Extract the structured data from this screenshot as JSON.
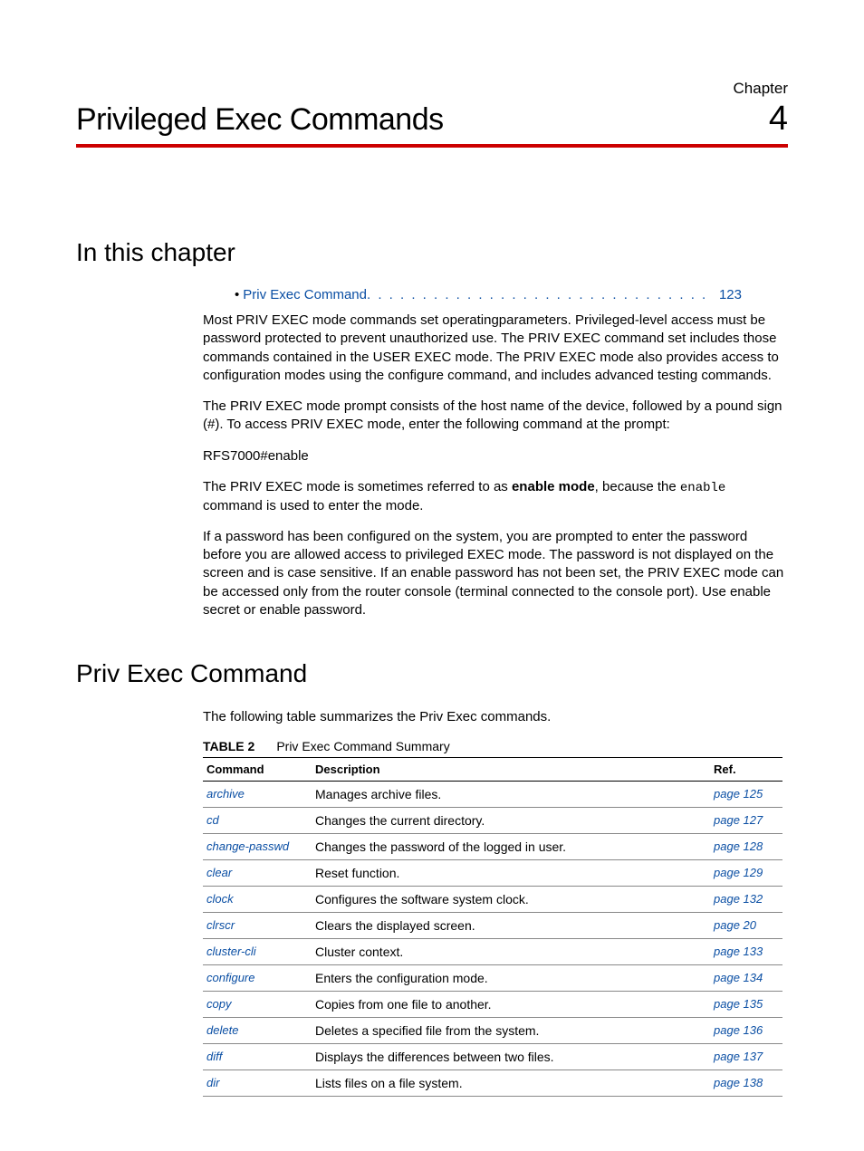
{
  "header": {
    "chapter_label": "Chapter",
    "title": "Privileged Exec Commands",
    "chapter_number": "4"
  },
  "section1": {
    "heading": "In this chapter",
    "toc": {
      "bullet": "•",
      "link_text": "Priv Exec Command",
      "dots": ". . . . . . . . . . . . . . . . . . . . . . . . . . . . . . . . . . . . . . . . . .",
      "page": "123"
    },
    "para1": "Most PRIV EXEC mode commands set operatingparameters. Privileged-level access must be password protected to prevent unauthorized use. The PRIV EXEC command set includes those commands contained in the USER EXEC mode. The PRIV EXEC mode also provides access to configuration modes using the configure command, and includes advanced testing commands.",
    "para2": "The PRIV EXEC mode prompt consists of the host name of the device, followed by a pound sign (#). To access PRIV EXEC mode, enter the following command at the prompt:",
    "code1": "RFS7000#enable",
    "para3_a": "The PRIV EXEC mode is sometimes referred to as ",
    "para3_b": "enable mode",
    "para3_c": ", because the ",
    "para3_d": "enable",
    "para3_e": " command is used to enter the mode.",
    "para4": "If a password has been configured on the system, you are prompted to enter the password before you are allowed access to privileged EXEC mode. The password is not displayed on the screen and is case sensitive. If an enable password has not been set, the PRIV EXEC mode can be accessed only from the router console (terminal connected to the console port). Use enable secret or enable password."
  },
  "section2": {
    "heading": "Priv Exec Command",
    "intro": "The following table summarizes the Priv Exec commands.",
    "table_label": "TABLE 2",
    "table_title": "Priv Exec Command Summary",
    "columns": {
      "c1": "Command",
      "c2": "Description",
      "c3": "Ref."
    },
    "rows": [
      {
        "cmd": "archive",
        "desc": "Manages archive files.",
        "ref": "page 125"
      },
      {
        "cmd": "cd",
        "desc": "Changes the current directory.",
        "ref": "page 127"
      },
      {
        "cmd": "change-passwd",
        "desc": "Changes the password of the logged in user.",
        "ref": "page 128"
      },
      {
        "cmd": "clear",
        "desc": "Reset function.",
        "ref": "page 129"
      },
      {
        "cmd": "clock",
        "desc": "Configures the software system clock.",
        "ref": "page 132"
      },
      {
        "cmd": "clrscr",
        "desc": "Clears the displayed screen.",
        "ref": "page 20"
      },
      {
        "cmd": "cluster-cli",
        "desc": "Cluster context.",
        "ref": "page 133"
      },
      {
        "cmd": "configure",
        "desc": "Enters the configuration mode.",
        "ref": "page 134"
      },
      {
        "cmd": "copy",
        "desc": "Copies from one file to another.",
        "ref": "page 135"
      },
      {
        "cmd": "delete",
        "desc": "Deletes a specified file from the system.",
        "ref": "page 136"
      },
      {
        "cmd": "diff",
        "desc": "Displays the differences between two files.",
        "ref": "page 137"
      },
      {
        "cmd": "dir",
        "desc": "Lists files on a file system.",
        "ref": "page 138"
      }
    ]
  }
}
